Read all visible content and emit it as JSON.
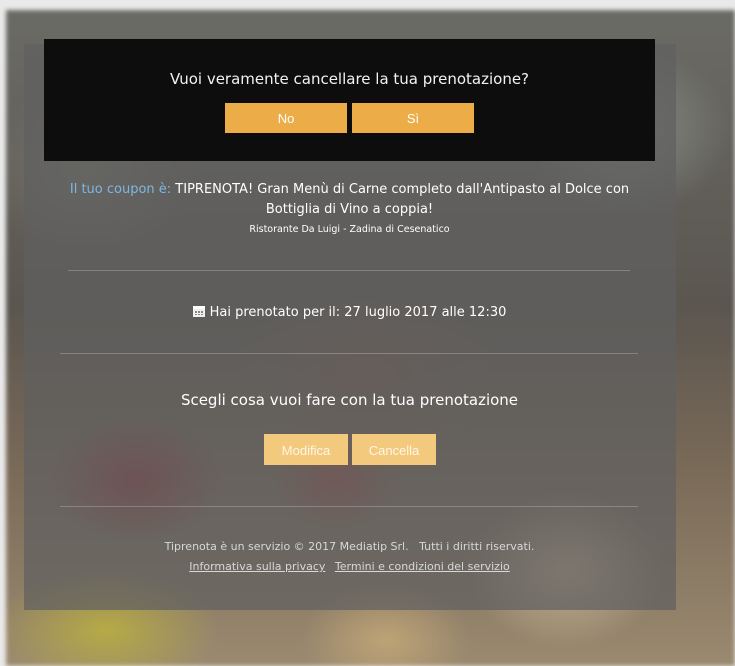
{
  "confirm": {
    "question": "Vuoi veramente cancellare la tua prenotazione?",
    "no_label": "No",
    "yes_label": "Sì"
  },
  "coupon": {
    "label": "Il tuo coupon è:",
    "text": "TIPRENOTA! Gran Menù di Carne completo dall'Antipasto al Dolce con Bottiglia di Vino a coppia!",
    "restaurant": "Ristorante Da Luigi - Zadina di Cesenatico"
  },
  "booking": {
    "icon": "calendar-icon",
    "text": "Hai prenotato per il: 27 luglio 2017 alle 12:30"
  },
  "actions": {
    "title": "Scegli cosa vuoi fare con la tua prenotazione",
    "edit_label": "Modifica",
    "cancel_label": "Cancella"
  },
  "footer": {
    "copyright": "Tiprenota è un servizio © 2017 Mediatip Srl.",
    "rights": "Tutti i diritti riservati.",
    "privacy_link": "Informativa sulla privacy",
    "terms_link": "Termini e condizioni del servizio"
  },
  "colors": {
    "accent": "#ecad48",
    "accent_disabled": "#f3c97e",
    "coupon_label": "#7fb7e0",
    "confirm_bg": "#0d0d0d"
  }
}
